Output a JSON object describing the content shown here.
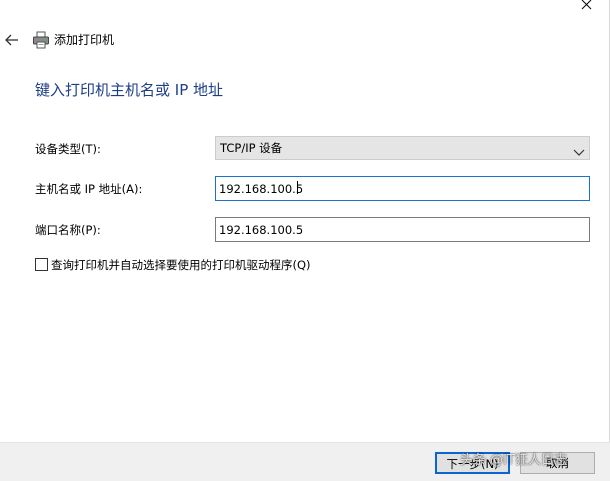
{
  "window": {
    "title": "添加打印机"
  },
  "heading": "键入打印机主机名或 IP 地址",
  "form": {
    "device_type_label": "设备类型(T):",
    "device_type_value": "TCP/IP 设备",
    "hostname_label": "主机名或 IP 地址(A):",
    "hostname_value": "192.168.100.5",
    "port_name_label": "端口名称(P):",
    "port_name_value": "192.168.100.5",
    "query_checkbox_label": "查询打印机并自动选择要使用的打印机驱动程序(Q)",
    "query_checkbox_checked": false
  },
  "footer": {
    "next_label": "下一步(N)",
    "cancel_label": "取消"
  },
  "watermark": "头条 @IT狂人日志",
  "icons": {
    "close": "close-icon",
    "back": "back-arrow-icon",
    "printer": "printer-icon",
    "dropdown": "chevron-down-icon"
  },
  "colors": {
    "heading": "#1e3f86",
    "focus_border": "#1a73c9",
    "footer_bg": "#f0f0f0"
  }
}
